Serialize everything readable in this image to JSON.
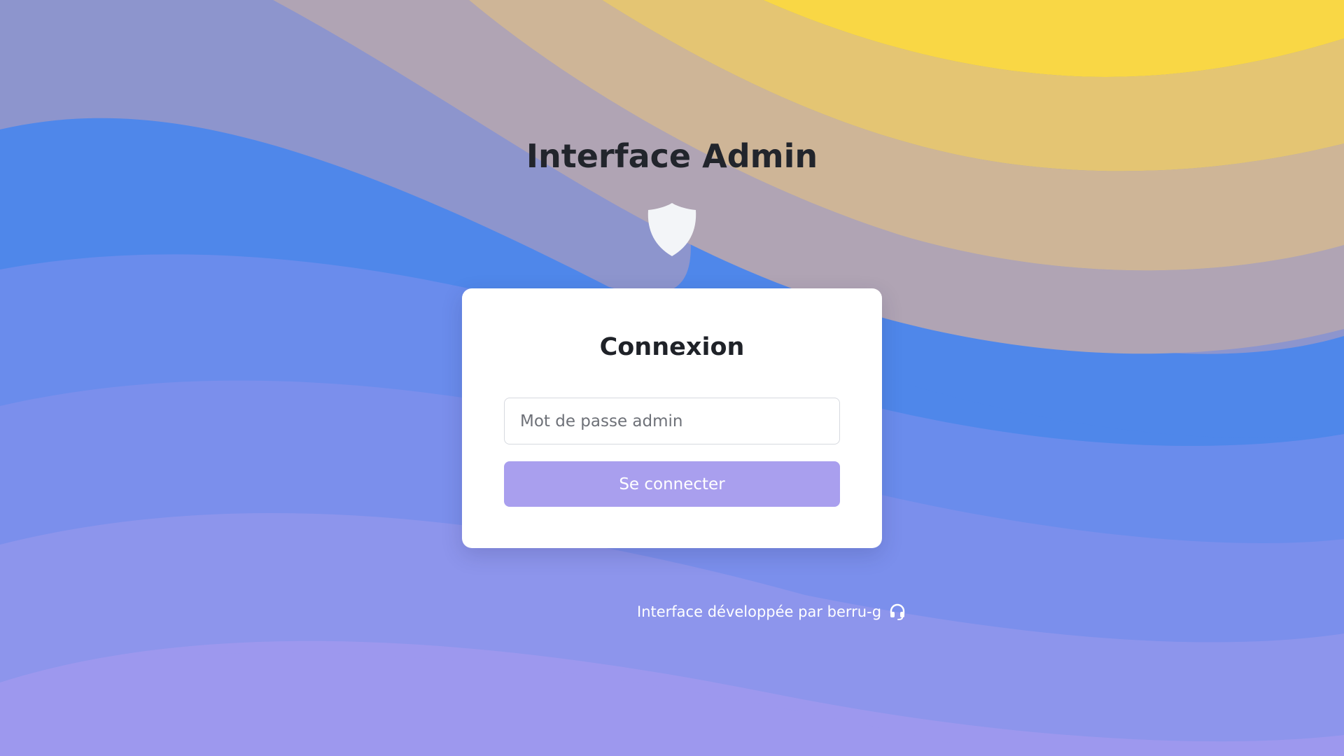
{
  "page": {
    "title": "Interface Admin",
    "shield_icon": "shield-icon"
  },
  "login_card": {
    "title": "Connexion",
    "password_field": {
      "value": "",
      "placeholder": "Mot de passe admin"
    },
    "submit_label": "Se connecter"
  },
  "footer": {
    "credit_text": "Interface développée par berru-g",
    "icon": "headset-icon"
  },
  "colors": {
    "button": "#a99fee",
    "title_text": "#22252c",
    "wave_yellow": "#f9d745",
    "wave_blue": "#4f87ea",
    "wave_lavender": "#9d98ee"
  }
}
